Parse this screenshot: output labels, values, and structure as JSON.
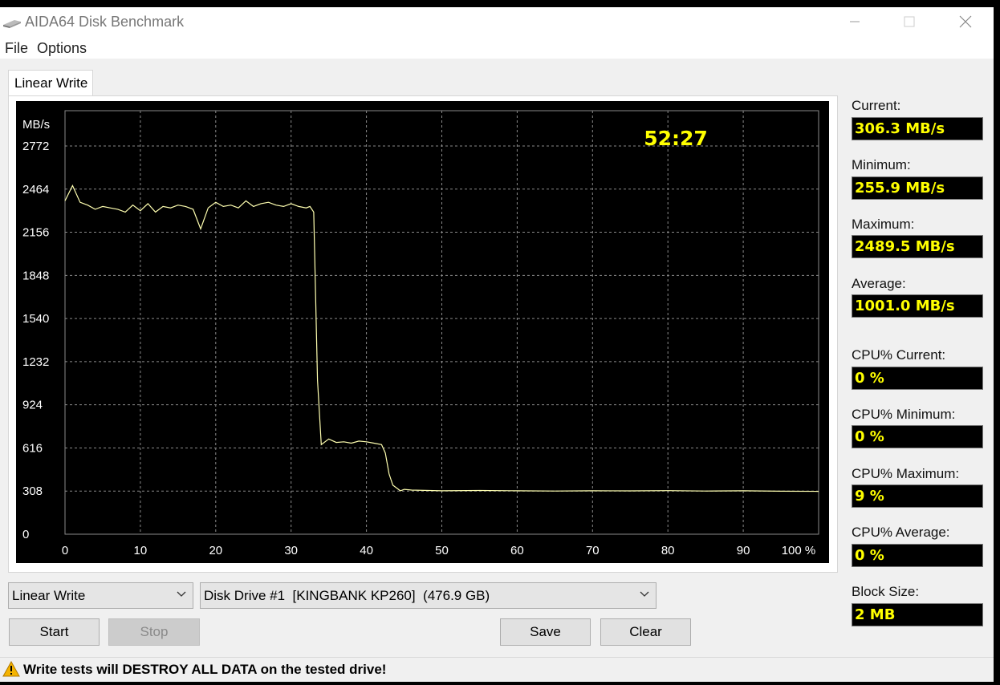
{
  "window": {
    "title": "AIDA64 Disk Benchmark"
  },
  "menu": {
    "file": "File",
    "options": "Options"
  },
  "tab": {
    "label": "Linear Write"
  },
  "chart_data": {
    "type": "line",
    "ylabel": "MB/s",
    "yticks": [
      "2772",
      "2464",
      "2156",
      "1848",
      "1540",
      "1232",
      "924",
      "616",
      "308",
      "0"
    ],
    "ylim": [
      0,
      2772
    ],
    "xticks": [
      "0",
      "10",
      "20",
      "30",
      "40",
      "50",
      "60",
      "70",
      "80",
      "90",
      "100 %"
    ],
    "xlim": [
      0,
      100
    ],
    "timer": "52:27",
    "colors": {
      "background": "#000000",
      "line": "#ffffb0",
      "grid": "#8a8a8a",
      "text": "#ffffff",
      "timer": "#ffff00"
    },
    "series": [
      {
        "x": [
          0,
          1,
          2,
          3,
          4,
          5,
          6,
          7,
          8,
          9,
          10,
          11,
          12,
          13,
          14,
          15,
          16,
          17,
          18,
          19,
          20,
          21,
          22,
          23,
          24,
          25,
          26,
          27,
          28,
          29,
          30,
          31,
          32,
          32.5,
          33,
          33.5,
          34,
          35,
          36,
          37,
          38,
          39,
          40,
          41,
          42,
          42.5,
          43,
          43.5,
          44,
          44.5,
          45,
          46,
          50,
          55,
          60,
          65,
          70,
          75,
          80,
          85,
          90,
          95,
          100
        ],
        "y": [
          2380,
          2489,
          2370,
          2350,
          2320,
          2340,
          2330,
          2320,
          2300,
          2350,
          2310,
          2360,
          2300,
          2340,
          2330,
          2350,
          2340,
          2320,
          2180,
          2330,
          2370,
          2340,
          2350,
          2330,
          2380,
          2340,
          2360,
          2370,
          2350,
          2340,
          2360,
          2340,
          2330,
          2340,
          2300,
          1100,
          640,
          680,
          655,
          660,
          650,
          665,
          660,
          650,
          640,
          580,
          430,
          350,
          330,
          310,
          320,
          315,
          310,
          312,
          310,
          308,
          310,
          309,
          311,
          308,
          310,
          307,
          306
        ]
      }
    ]
  },
  "stats": {
    "current_label": "Current:",
    "current_value": "306.3 MB/s",
    "minimum_label": "Minimum:",
    "minimum_value": "255.9 MB/s",
    "maximum_label": "Maximum:",
    "maximum_value": "2489.5 MB/s",
    "average_label": "Average:",
    "average_value": "1001.0 MB/s",
    "cpu_current_label": "CPU% Current:",
    "cpu_current_value": "0 %",
    "cpu_minimum_label": "CPU% Minimum:",
    "cpu_minimum_value": "0 %",
    "cpu_maximum_label": "CPU% Maximum:",
    "cpu_maximum_value": "9 %",
    "cpu_average_label": "CPU% Average:",
    "cpu_average_value": "0 %",
    "block_size_label": "Block Size:",
    "block_size_value": "2 MB"
  },
  "controls": {
    "test_select": "Linear Write",
    "drive_select": "Disk Drive #1  [KINGBANK KP260]  (476.9 GB)",
    "start": "Start",
    "stop": "Stop",
    "save": "Save",
    "clear": "Clear"
  },
  "status": {
    "warning": "Write tests will DESTROY ALL DATA on the tested drive!"
  }
}
